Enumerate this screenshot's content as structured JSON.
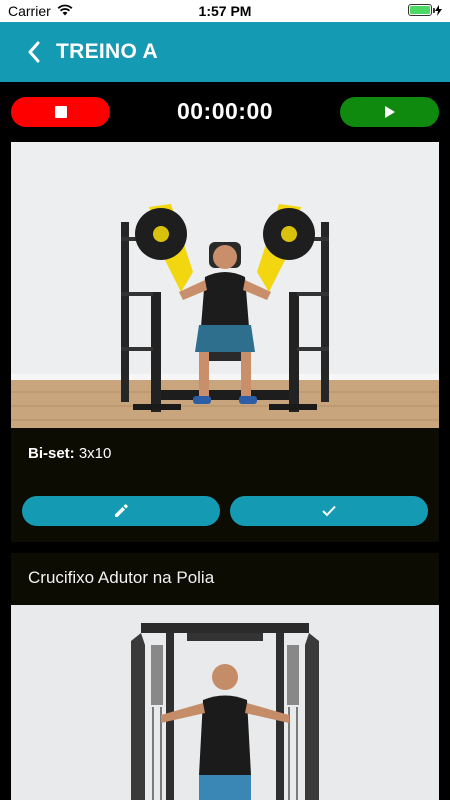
{
  "status_bar": {
    "carrier": "Carrier",
    "time": "1:57 PM"
  },
  "header": {
    "title": "TREINO A",
    "back_icon": "chevron-left-icon",
    "color": "#159ab3"
  },
  "timer": {
    "value": "00:00:00",
    "stop_icon": "stop-icon",
    "stop_color": "#ff0000",
    "play_icon": "play-icon",
    "play_color": "#0f8a0f"
  },
  "exercises": [
    {
      "image": "chest-press-machine-photo",
      "set_label": "Bi-set:",
      "set_value": "3x10",
      "edit_icon": "pencil-icon",
      "done_icon": "check-icon"
    },
    {
      "title": "Crucifixo Adutor na Polia",
      "image": "cable-crossover-photo"
    }
  ]
}
